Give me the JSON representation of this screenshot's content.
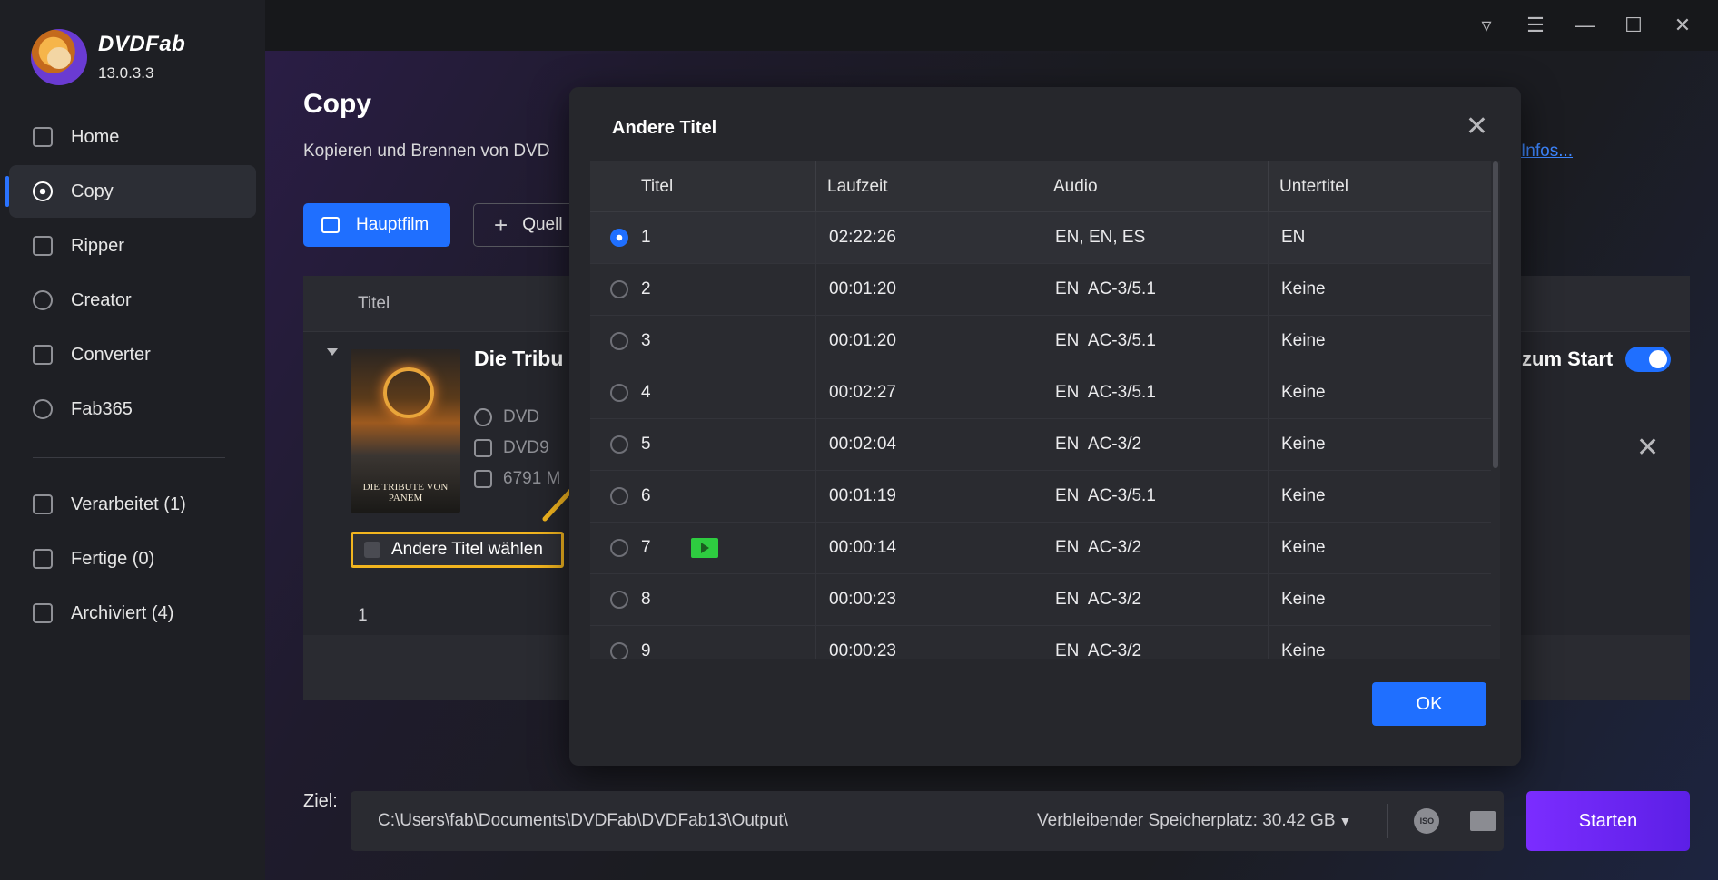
{
  "app": {
    "name": "DVDFab",
    "version": "13.0.3.3"
  },
  "sidebar": {
    "items": [
      {
        "label": "Home",
        "icon": "home-icon"
      },
      {
        "label": "Copy",
        "icon": "copy-icon",
        "active": true
      },
      {
        "label": "Ripper",
        "icon": "ripper-icon"
      },
      {
        "label": "Creator",
        "icon": "creator-icon"
      },
      {
        "label": "Converter",
        "icon": "converter-icon"
      },
      {
        "label": "Fab365",
        "icon": "fab365-icon"
      }
    ],
    "queue": [
      {
        "label": "Verarbeitet (1)",
        "icon": "processing-icon"
      },
      {
        "label": "Fertige (0)",
        "icon": "finished-icon"
      },
      {
        "label": "Archiviert (4)",
        "icon": "archive-icon"
      }
    ]
  },
  "page": {
    "title": "Copy",
    "subtitle": "Kopieren und Brennen von DVD",
    "info_link": "Infos...",
    "main_button": "Hauptfilm",
    "source_button": "Quell"
  },
  "list": {
    "header_title": "Titel",
    "movie_title": "Die Tribu",
    "poster_caption": "DIE TRIBUTE VON PANEM",
    "meta_type": "DVD",
    "meta_disc": "DVD9",
    "meta_size": "6791 M",
    "choose_button": "Andere Titel wählen",
    "row_number": "1",
    "zum_start": "zum Start"
  },
  "modal": {
    "title": "Andere Titel",
    "columns": [
      "Titel",
      "Laufzeit",
      "Audio",
      "Untertitel"
    ],
    "rows": [
      {
        "titel": "1",
        "laufzeit": "02:22:26",
        "audio": "EN, EN, ES",
        "untertitel": "EN",
        "selected": true
      },
      {
        "titel": "2",
        "laufzeit": "00:01:20",
        "audio": "EN  AC-3/5.1",
        "untertitel": "Keine"
      },
      {
        "titel": "3",
        "laufzeit": "00:01:20",
        "audio": "EN  AC-3/5.1",
        "untertitel": "Keine"
      },
      {
        "titel": "4",
        "laufzeit": "00:02:27",
        "audio": "EN  AC-3/5.1",
        "untertitel": "Keine"
      },
      {
        "titel": "5",
        "laufzeit": "00:02:04",
        "audio": "EN  AC-3/2",
        "untertitel": "Keine"
      },
      {
        "titel": "6",
        "laufzeit": "00:01:19",
        "audio": "EN  AC-3/5.1",
        "untertitel": "Keine"
      },
      {
        "titel": "7",
        "laufzeit": "00:00:14",
        "audio": "EN  AC-3/2",
        "untertitel": "Keine",
        "play": true
      },
      {
        "titel": "8",
        "laufzeit": "00:00:23",
        "audio": "EN  AC-3/2",
        "untertitel": "Keine"
      },
      {
        "titel": "9",
        "laufzeit": "00:00:23",
        "audio": "EN  AC-3/2",
        "untertitel": "Keine"
      }
    ],
    "ok_button": "OK"
  },
  "bottom": {
    "target_label": "Ziel:",
    "path": "C:\\Users\\fab\\Documents\\DVDFab\\DVDFab13\\Output\\",
    "space": "Verbleibender Speicherplatz: 30.42 GB",
    "iso_label": "ISO",
    "start_button": "Starten"
  },
  "colors": {
    "accent": "#1f6fff",
    "start": "#6a24f5",
    "highlight": "#f2b51f"
  }
}
